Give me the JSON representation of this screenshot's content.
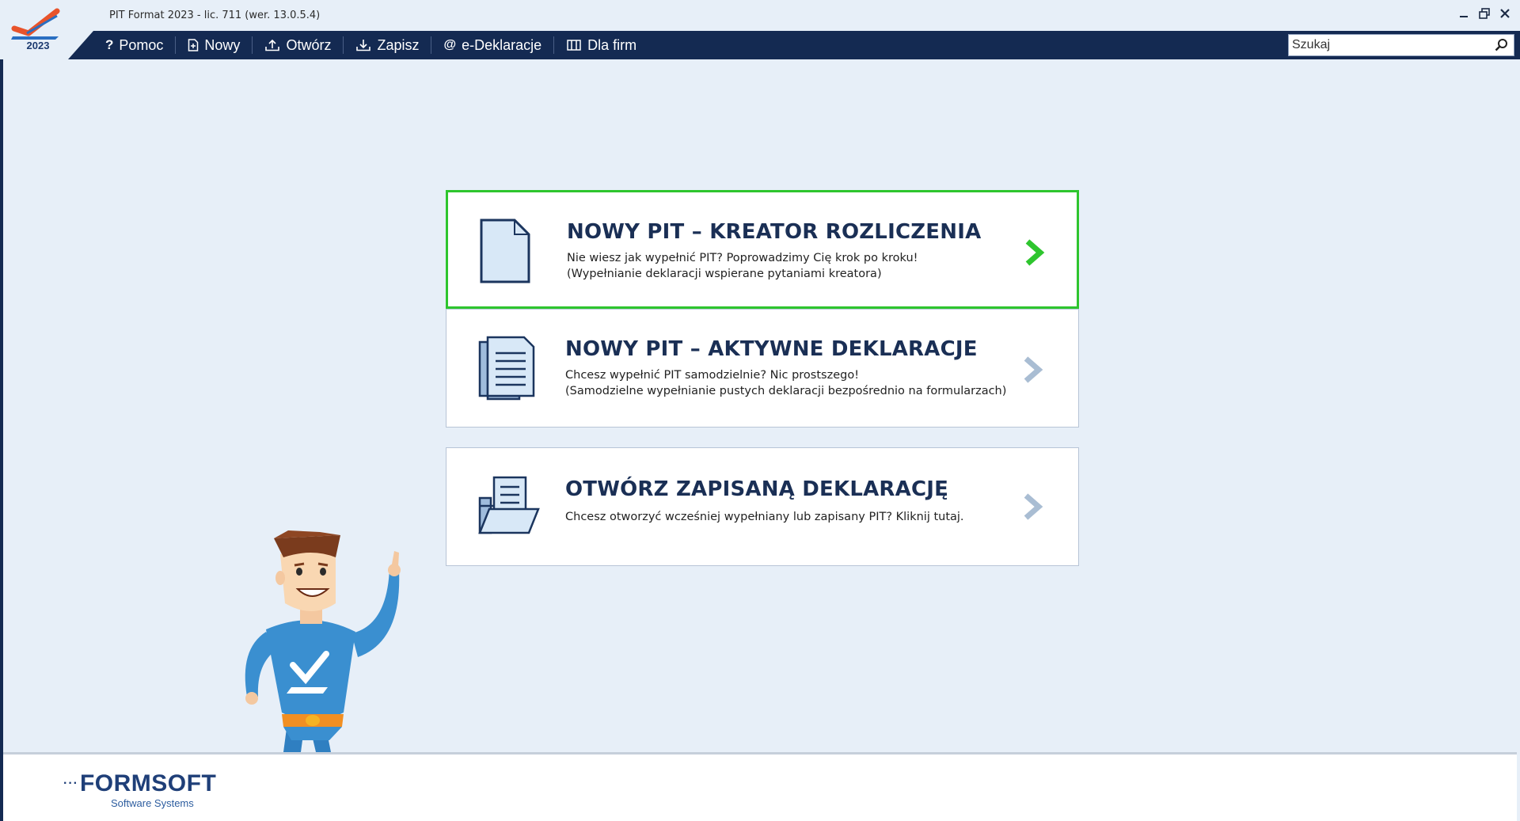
{
  "window": {
    "title": "PIT Format 2023 - lic. 711 (wer. 13.0.5.4)",
    "logo_year": "2023",
    "controls": {
      "minimize": "–",
      "restore": "⧉",
      "close": "✕"
    }
  },
  "navbar": {
    "items": [
      {
        "id": "pomoc",
        "label": "Pomoc",
        "icon": "question-icon"
      },
      {
        "id": "nowy",
        "label": "Nowy",
        "icon": "new-document-icon"
      },
      {
        "id": "otworz",
        "label": "Otwórz",
        "icon": "upload-icon"
      },
      {
        "id": "zapisz",
        "label": "Zapisz",
        "icon": "download-icon"
      },
      {
        "id": "edeklaracje",
        "label": "e-Deklaracje",
        "icon": "at-icon"
      },
      {
        "id": "dlafirm",
        "label": "Dla firm",
        "icon": "building-icon"
      }
    ],
    "search": {
      "placeholder": "Szukaj",
      "value": ""
    }
  },
  "cards": [
    {
      "title": "NOWY PIT – KREATOR ROZLICZENIA",
      "line1": "Nie wiesz jak wypełnić PIT? Poprowadzimy Cię krok po kroku!",
      "line2": "(Wypełnianie deklaracji wspierane pytaniami kreatora)",
      "icon": "document-icon",
      "active": true
    },
    {
      "title": "NOWY PIT – AKTYWNE DEKLARACJE",
      "line1": "Chcesz wypełnić PIT samodzielnie? Nic prostszego!",
      "line2": "(Samodzielne wypełnianie pustych deklaracji bezpośrednio na formularzach)",
      "icon": "documents-stack-icon",
      "active": false
    },
    {
      "title": "OTWÓRZ ZAPISANĄ DEKLARACJĘ",
      "line1": "Chcesz otworzyć wcześniej wypełniany lub zapisany PIT? Kliknij tutaj.",
      "icon": "open-folder-icon",
      "active": false
    }
  ],
  "footer": {
    "brand": "FORMSOFT",
    "brand_sub": "Software Systems"
  },
  "colors": {
    "navbar": "#142a52",
    "background": "#e7eff8",
    "active_border": "#2ec52e",
    "title_text": "#1a2f55",
    "mascot_blue": "#3a8fd0"
  }
}
